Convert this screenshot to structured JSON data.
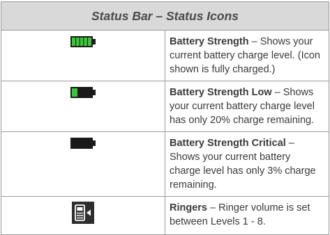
{
  "table": {
    "title": "Status Bar – Status Icons",
    "rows": [
      {
        "icon": "battery-full-icon",
        "name": "Battery Strength",
        "separator": " – ",
        "description": "Shows your current battery charge level. (Icon shown is fully charged.)"
      },
      {
        "icon": "battery-low-icon",
        "name": "Battery Strength Low",
        "separator": " – ",
        "description": "Shows your current battery charge level has only 20% charge remaining."
      },
      {
        "icon": "battery-critical-icon",
        "name": "Battery Strength Critical",
        "separator": " – ",
        "description": "Shows your current battery charge level has only 3% charge remaining."
      },
      {
        "icon": "ringer-icon",
        "name": "Ringers",
        "separator": " – ",
        "description": "Ringer volume is set between Levels 1 - 8."
      }
    ]
  },
  "colors": {
    "header_background": "#d9d9d9",
    "battery_fill": "#37c837",
    "battery_body": "#1a1a1a",
    "ringer_background": "#2e2e2e"
  }
}
